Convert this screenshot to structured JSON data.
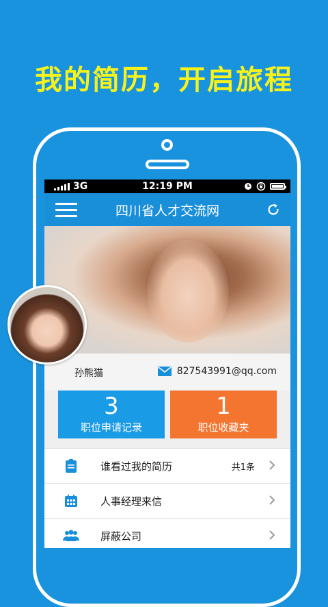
{
  "slogan": "我的简历，开启旅程",
  "status_bar": {
    "network": "3G",
    "time": "12:19 PM"
  },
  "header": {
    "title": "四川省人才交流网"
  },
  "profile": {
    "name": "孙熊猫",
    "email": "827543991@qq.com"
  },
  "stats": [
    {
      "value": "3",
      "label": "职位申请记录"
    },
    {
      "value": "1",
      "label": "职位收藏夹"
    }
  ],
  "menu_items": [
    {
      "label": "谁看过我的简历",
      "count": "共1条",
      "icon": "clipboard-icon"
    },
    {
      "label": "人事经理来信",
      "icon": "calendar-icon"
    },
    {
      "label": "屏蔽公司",
      "icon": "users-icon"
    }
  ],
  "colors": {
    "background": "#1a93de",
    "slogan": "#f6f21b",
    "header": "#1a8fd9",
    "stat_blue": "#1a9be5",
    "stat_orange": "#f4752f"
  }
}
